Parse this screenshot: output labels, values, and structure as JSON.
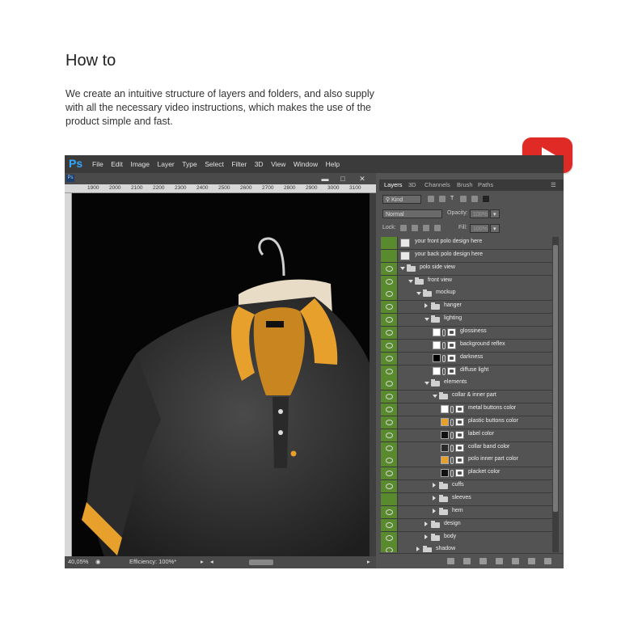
{
  "page": {
    "heading": "How to",
    "intro": "We create an intuitive structure of layers and folders, and also supply with all the necessary video instructions, which makes the use of the product simple and fast."
  },
  "youtube": {
    "icon": "youtube-play-icon",
    "color": "#e02a25"
  },
  "app": {
    "logo": "Ps",
    "menu": [
      "File",
      "Edit",
      "Image",
      "Layer",
      "Type",
      "Select",
      "Filter",
      "3D",
      "View",
      "Window",
      "Help"
    ]
  },
  "document": {
    "ruler_ticks": [
      "1900",
      "2000",
      "2100",
      "2200",
      "2300",
      "2400",
      "2500",
      "2600",
      "2700",
      "2800",
      "2900",
      "3000",
      "3100"
    ],
    "zoom": "40,05%",
    "efficiency": "Efficiency: 100%*"
  },
  "panel": {
    "tabs": [
      "Layers",
      "3D",
      "Channels",
      "Brush",
      "Paths"
    ],
    "filter_kind": "Kind",
    "blend_mode": "Normal",
    "opacity_label": "Opacity:",
    "opacity_value": "100%",
    "lock_label": "Lock:",
    "fill_label": "Fill:",
    "fill_value": "100%"
  },
  "layers": [
    {
      "name": "your front polo design here",
      "depth": 0,
      "kind": "smart",
      "visible": false
    },
    {
      "name": "your back polo design here",
      "depth": 0,
      "kind": "smart",
      "visible": false
    },
    {
      "name": "polo side view",
      "depth": 0,
      "kind": "folder",
      "open": true,
      "visible": true
    },
    {
      "name": "front view",
      "depth": 1,
      "kind": "folder",
      "open": true,
      "visible": true
    },
    {
      "name": "mockup",
      "depth": 2,
      "kind": "folder",
      "open": true,
      "visible": true
    },
    {
      "name": "hanger",
      "depth": 3,
      "kind": "folder",
      "open": false,
      "visible": true
    },
    {
      "name": "lighting",
      "depth": 3,
      "kind": "folder",
      "open": true,
      "visible": true
    },
    {
      "name": "glossiness",
      "depth": 4,
      "kind": "adjust",
      "swatch": "#ffffff",
      "visible": true
    },
    {
      "name": "background reflex",
      "depth": 4,
      "kind": "adjust",
      "swatch": "#ffffff",
      "visible": true
    },
    {
      "name": "darkness",
      "depth": 4,
      "kind": "adjust",
      "swatch": "#000000",
      "visible": true
    },
    {
      "name": "diffuse light",
      "depth": 4,
      "kind": "adjust",
      "swatch": "#ffffff",
      "visible": true
    },
    {
      "name": "elements",
      "depth": 3,
      "kind": "folder",
      "open": true,
      "visible": true
    },
    {
      "name": "collar & inner part",
      "depth": 4,
      "kind": "folder",
      "open": true,
      "visible": true
    },
    {
      "name": "metal buttons color",
      "depth": 5,
      "kind": "adjust",
      "swatch": "#ffffff",
      "visible": true
    },
    {
      "name": "plastic buttons color",
      "depth": 5,
      "kind": "adjust",
      "swatch": "#e8a02c",
      "visible": true
    },
    {
      "name": "label color",
      "depth": 5,
      "kind": "adjust",
      "swatch": "#111111",
      "visible": true
    },
    {
      "name": "collar band color",
      "depth": 5,
      "kind": "adjust",
      "swatch": "#2a2a2a",
      "visible": true
    },
    {
      "name": "polo inner part color",
      "depth": 5,
      "kind": "adjust",
      "swatch": "#e8a02c",
      "visible": true
    },
    {
      "name": "placket color",
      "depth": 5,
      "kind": "adjust",
      "swatch": "#111111",
      "visible": true
    },
    {
      "name": "cuffs",
      "depth": 4,
      "kind": "folder",
      "open": false,
      "visible": true
    },
    {
      "name": "sleeves",
      "depth": 4,
      "kind": "folder",
      "open": false,
      "visible": false
    },
    {
      "name": "hem",
      "depth": 4,
      "kind": "folder",
      "open": false,
      "visible": true
    },
    {
      "name": "design",
      "depth": 3,
      "kind": "folder",
      "open": false,
      "visible": true
    },
    {
      "name": "body",
      "depth": 3,
      "kind": "folder",
      "open": false,
      "visible": true
    },
    {
      "name": "shadow",
      "depth": 2,
      "kind": "folder",
      "open": false,
      "visible": true
    }
  ],
  "colors": {
    "eye_column": "#5a8a2e",
    "polo_body": "#3a3a3a",
    "polo_trim": "#e8a02c",
    "hanger_wood": "#e8dcc6"
  }
}
